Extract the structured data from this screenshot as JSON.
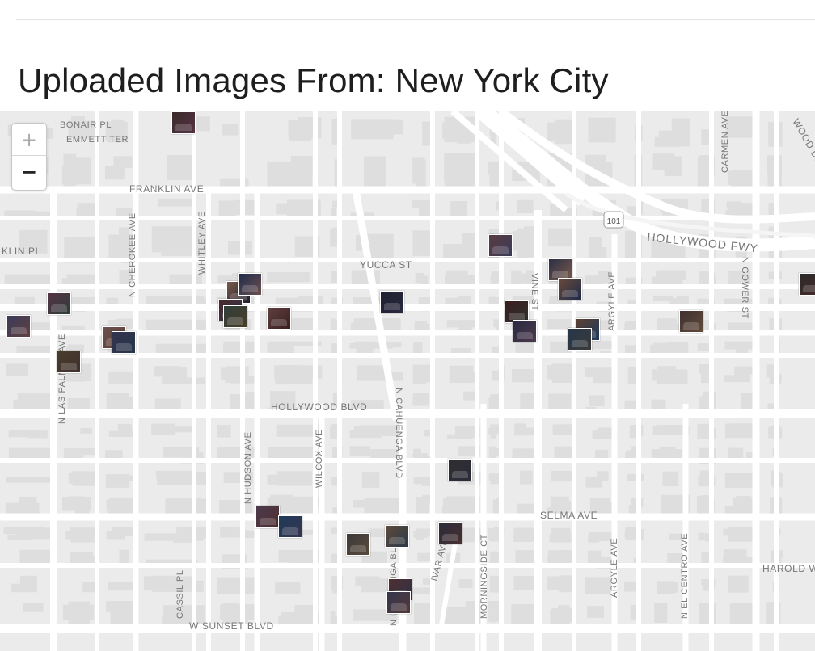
{
  "page": {
    "title": "Uploaded Images From: New York City"
  },
  "map": {
    "zoom_in_label": "+",
    "zoom_out_label": "−",
    "colors": {
      "land": "#ebebeb",
      "block": "#dedede",
      "road": "#ffffff",
      "label": "#777777"
    },
    "labels": {
      "bonair": "BONAIR PL",
      "emmett": "EMMETT TER",
      "franklin": "FRANKLIN AVE",
      "carlin": "KLIN PL",
      "cherokee": "N CHEROKEE AVE",
      "whitley": "WHITLEY AVE",
      "laspalmas": "N LAS PALMAS AVE",
      "yucca": "YUCCA ST",
      "cahuenga": "N CAHUENGA BLVD",
      "vine": "VINE ST",
      "argyle1": "ARGYLE AVE",
      "gower": "N GOWER ST",
      "carmen": "CARMEN AVE",
      "fwy": "HOLLYWOOD FWY",
      "shield": "101",
      "hollywood": "HOLLYWOOD BLVD",
      "hudson": "N HUDSON AVE",
      "wilcox": "WILCOX AVE",
      "selma": "SELMA AVE",
      "morningside": "MORNINGSIDE CT",
      "ivar": "IVAR AVE",
      "argyle2": "ARGYLE AVE",
      "elcentro": "N EL CENTRO AVE",
      "harold": "HAROLD WAY",
      "cassil": "CASSIL PL",
      "sunset": "W SUNSET BLVD",
      "cahuenga2": "N CAHUENGA BLVD",
      "wood": "WOOD DR"
    },
    "photo_colors": [
      "#3a2a2a",
      "#5a3b3f",
      "#2b2f46",
      "#6a4a3a",
      "#2a2a2a",
      "#553344",
      "#3b3b5a",
      "#7a5a4a",
      "#1e2b4a",
      "#4a2a2a",
      "#2f3e3a",
      "#604040",
      "#1f1f2f",
      "#6b5050",
      "#33334d",
      "#4a3d2a",
      "#3a1f1f",
      "#292940",
      "#5c4033",
      "#26364a",
      "#403030",
      "#2f2f2f",
      "#4d3a4d",
      "#1e3a5a",
      "#3a3a3a",
      "#604a3a",
      "#2b2b3b",
      "#4f2f2f",
      "#36364f",
      "#5a4a3a",
      "#2a3a4a",
      "#463030",
      "#303048",
      "#523838",
      "#2c2c2c"
    ]
  }
}
